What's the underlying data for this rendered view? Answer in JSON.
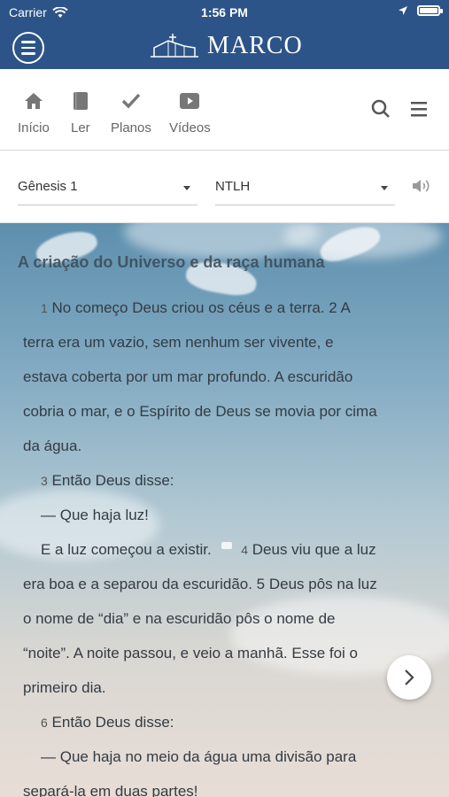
{
  "status": {
    "carrier": "Carrier",
    "time": "1:56 PM"
  },
  "header": {
    "brand": "MARCO"
  },
  "nav": {
    "tabs": [
      {
        "label": "Início",
        "icon": "home-icon"
      },
      {
        "label": "Ler",
        "icon": "book-icon"
      },
      {
        "label": "Planos",
        "icon": "check-icon"
      },
      {
        "label": "Vídeos",
        "icon": "video-icon"
      }
    ]
  },
  "selectors": {
    "book": "Gênesis 1",
    "version": "NTLH"
  },
  "reader": {
    "heading": "A criação do Universo e da raça humana",
    "lines": {
      "l1_num": "1",
      "l1": "No começo Deus criou os céus e a terra. 2 A",
      "l2": "terra era um vazio, sem nenhum ser vivente, e",
      "l3": "estava coberta por um mar profundo. A escuridão",
      "l4": "cobria o mar, e o Espírito de Deus se movia por cima",
      "l5": "da água.",
      "l6_num": "3",
      "l6": "Então Deus disse:",
      "l7": "— Que haja luz!",
      "l8a": "E a luz começou a existir.",
      "l8_num": "4",
      "l8b": "Deus viu que a luz",
      "l9": "era boa e a separou da escuridão. 5 Deus pôs na luz",
      "l10": "o nome de “dia” e na escuridão pôs o nome de",
      "l11": "“noite”. A noite passou, e veio a manhã. Esse foi o",
      "l12": "primeiro dia.",
      "l13_num": "6",
      "l13": "Então Deus disse:",
      "l14": "— Que haja no meio da água uma divisão para",
      "l15": "separá-la em duas partes!"
    }
  }
}
